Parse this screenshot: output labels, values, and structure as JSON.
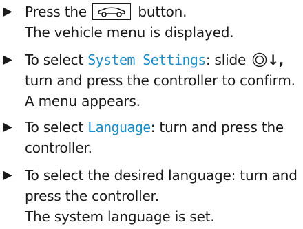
{
  "steps": [
    {
      "bullet": "▶",
      "lines": [
        {
          "pre": "Press the",
          "post": "button."
        },
        {
          "text": "The vehicle menu is displayed."
        }
      ],
      "icon": "car-icon"
    },
    {
      "bullet": "▶",
      "lines": [
        {
          "pre": "To select ",
          "highlight": "System Settings",
          "post": ": slide"
        },
        {
          "text": "turn and press the controller to confirm."
        },
        {
          "text": "A menu appears."
        }
      ],
      "icon": "controller-slide-down-icon",
      "arrow": "↓,"
    },
    {
      "bullet": "▶",
      "lines": [
        {
          "pre": "To select ",
          "highlight": "Language",
          "post": ": turn and press the"
        },
        {
          "text": "controller."
        }
      ]
    },
    {
      "bullet": "▶",
      "lines": [
        {
          "text": "To select the desired language: turn and"
        },
        {
          "text": "press the controller."
        },
        {
          "text": "The system language is set."
        }
      ]
    }
  ],
  "colors": {
    "highlight": "#1b8fc9",
    "text": "#1a1a1a"
  }
}
